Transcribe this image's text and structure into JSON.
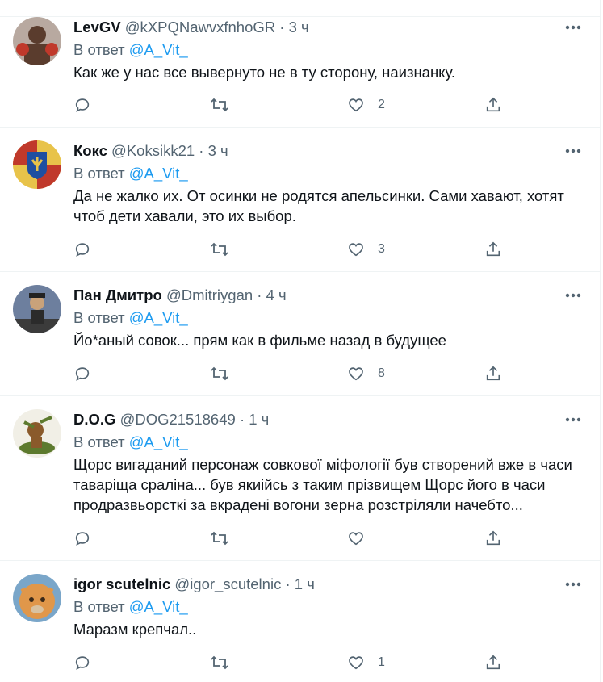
{
  "reply_prefix": "В ответ",
  "tweets": [
    {
      "name": "LevGV",
      "handle": "@kXPQNawvxfnhoGR",
      "sep": "·",
      "time": "3 ч",
      "mention": "@A_Vit_",
      "lines": [
        "Как же у нас все вывернуто не в ту сторону, наизнанку."
      ],
      "likes": "2",
      "avatar_colors": [
        "#b8a9a0",
        "#5a3c2d",
        "#c0392b"
      ]
    },
    {
      "name": "Кокс",
      "handle": "@Koksikk21",
      "sep": "·",
      "time": "3 ч",
      "mention": "@A_Vit_",
      "lines": [
        "Да не жалко их. От осинки не родятся апельсинки. Сами хавают, хотят",
        "чтоб дети хавали, это их выбор."
      ],
      "likes": "3",
      "avatar_colors": [
        "#1f4fa0",
        "#e8c34a",
        "#c0392b"
      ]
    },
    {
      "name": "Пан Дмитро",
      "handle": "@Dmitriygan",
      "sep": "·",
      "time": "4 ч",
      "mention": "@A_Vit_",
      "lines": [
        "Йо*аный совок... прям как в фильме назад в будущее"
      ],
      "likes": "8",
      "avatar_colors": [
        "#6d7f9e",
        "#3b3b3b",
        "#c9a27a"
      ]
    },
    {
      "name": "D.O.G",
      "handle": "@DOG21518649",
      "sep": "·",
      "time": "1 ч",
      "mention": "@A_Vit_",
      "lines": [
        "Щорс вигаданий персонаж совкової міфології був створений вже в часи",
        "таваріща сраліна... був якиійсь з таким прізвищем Щорс його в часи",
        "продразвьорсткі за вкрадені вогони зерна розстріляли начебто..."
      ],
      "likes": "",
      "avatar_colors": [
        "#f1efe6",
        "#5d7a2e",
        "#8a5a2b"
      ]
    },
    {
      "name": "igor scutelnic",
      "handle": "@igor_scutelnic",
      "sep": "·",
      "time": "1 ч",
      "mention": "@A_Vit_",
      "lines": [
        "Маразм крепчал.."
      ],
      "likes": "1",
      "avatar_colors": [
        "#d9c2a0",
        "#e0974a",
        "#7aa6c9"
      ]
    }
  ]
}
